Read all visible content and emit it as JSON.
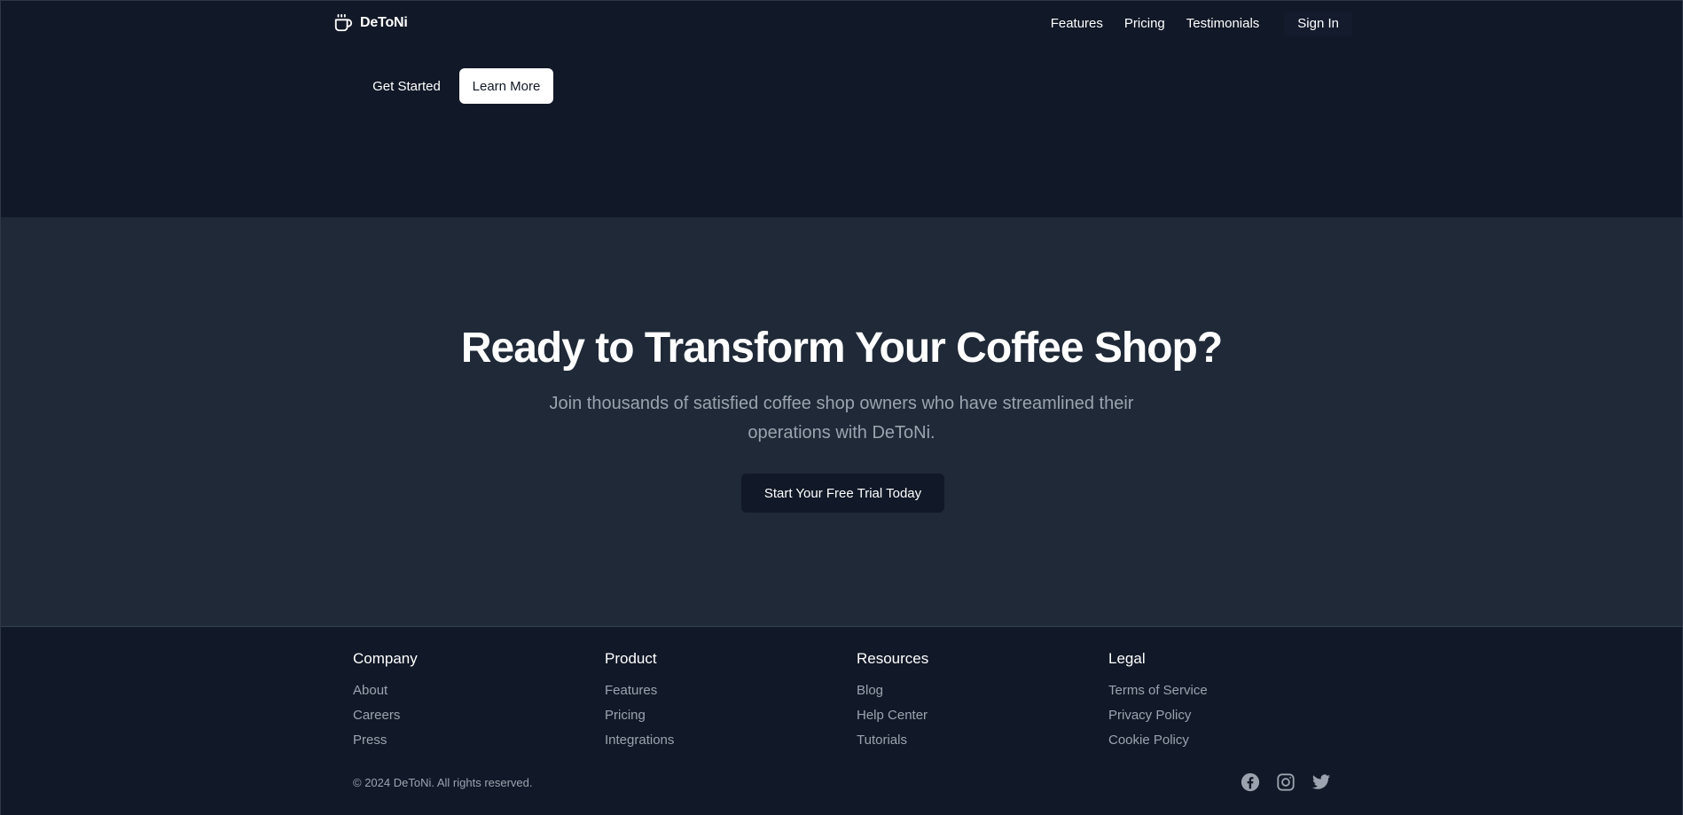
{
  "header": {
    "brand_name": "DeToNi",
    "brand_icon": "coffee-cup-icon",
    "nav": [
      {
        "label": "Features"
      },
      {
        "label": "Pricing"
      },
      {
        "label": "Testimonials"
      }
    ],
    "sign_in_label": "Sign In"
  },
  "hero": {
    "get_started_label": "Get Started",
    "learn_more_label": "Learn More"
  },
  "cta": {
    "title": "Ready to Transform Your Coffee Shop?",
    "subtitle": "Join thousands of satisfied coffee shop owners who have streamlined their operations with DeToNi.",
    "button_label": "Start Your Free Trial Today"
  },
  "footer": {
    "columns": [
      {
        "heading": "Company",
        "links": [
          "About",
          "Careers",
          "Press"
        ]
      },
      {
        "heading": "Product",
        "links": [
          "Features",
          "Pricing",
          "Integrations"
        ]
      },
      {
        "heading": "Resources",
        "links": [
          "Blog",
          "Help Center",
          "Tutorials"
        ]
      },
      {
        "heading": "Legal",
        "links": [
          "Terms of Service",
          "Privacy Policy",
          "Cookie Policy"
        ]
      }
    ],
    "copyright": "© 2024 DeToNi. All rights reserved.",
    "social_icons": [
      "facebook-icon",
      "instagram-icon",
      "twitter-icon"
    ]
  },
  "colors": {
    "background": "#111827",
    "cta_background": "#1f2937",
    "muted_text": "#9ca3af",
    "primary_text": "#ffffff"
  }
}
